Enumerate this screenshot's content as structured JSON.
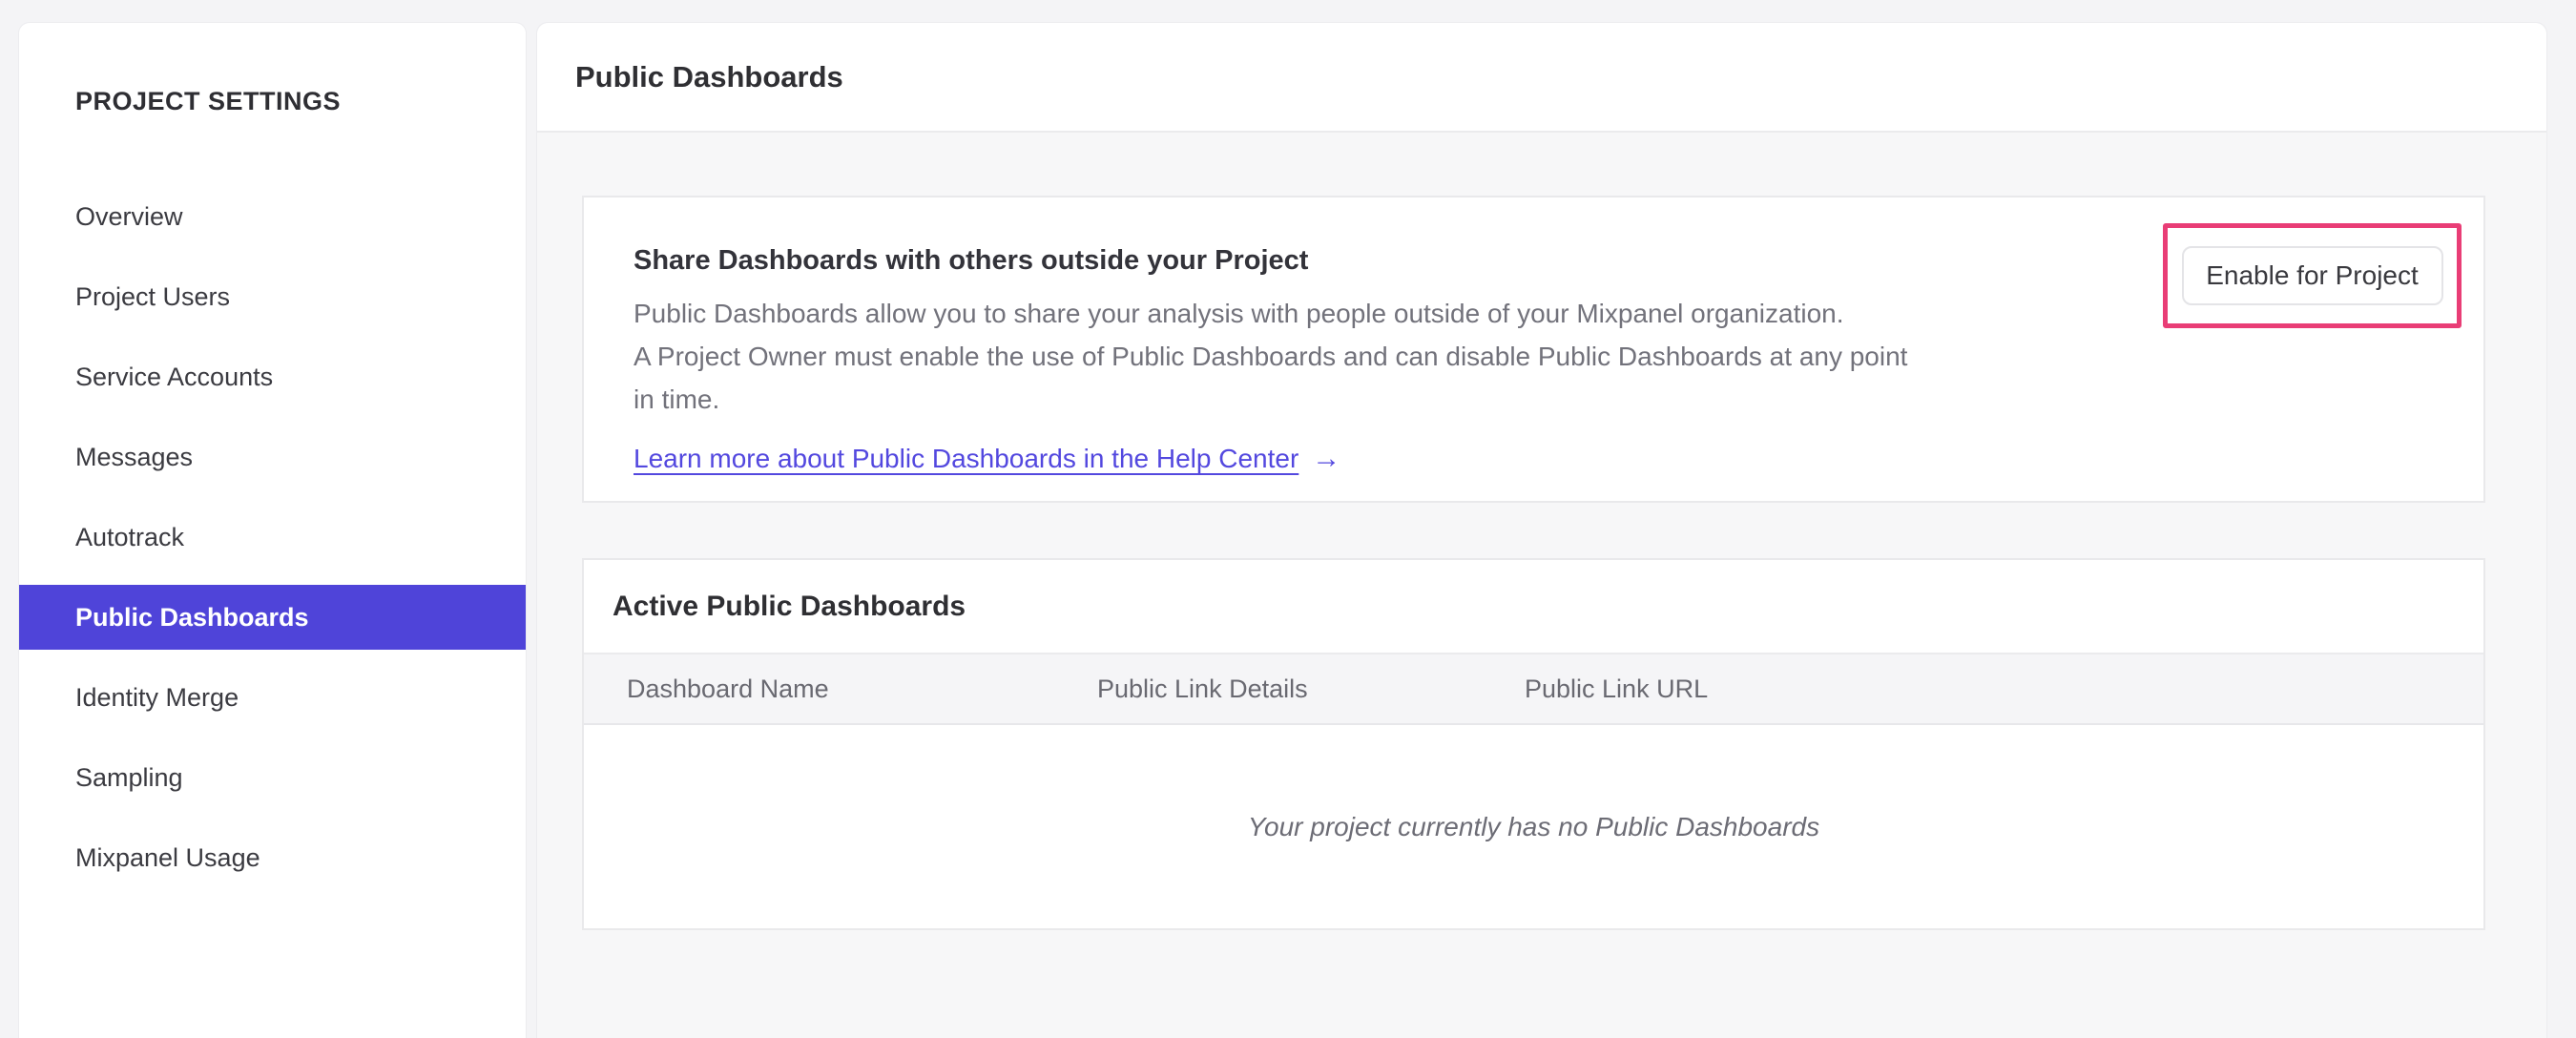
{
  "colors": {
    "accent_purple": "#4f44d9",
    "annotation_pink": "#e93d76",
    "link_purple": "#5348df",
    "page_background": "#f4f4f6"
  },
  "sidebar": {
    "title": "PROJECT SETTINGS",
    "items": [
      {
        "label": "Overview",
        "active": false
      },
      {
        "label": "Project Users",
        "active": false
      },
      {
        "label": "Service Accounts",
        "active": false
      },
      {
        "label": "Messages",
        "active": false
      },
      {
        "label": "Autotrack",
        "active": false
      },
      {
        "label": "Public Dashboards",
        "active": true
      },
      {
        "label": "Identity Merge",
        "active": false
      },
      {
        "label": "Sampling",
        "active": false
      },
      {
        "label": "Mixpanel Usage",
        "active": false
      }
    ]
  },
  "header": {
    "title": "Public Dashboards"
  },
  "share_card": {
    "title": "Share Dashboards with others outside your Project",
    "body_lines": [
      "Public Dashboards allow you to share your analysis with people outside of your Mixpanel organization.",
      "A Project Owner must enable the use of Public Dashboards and can disable Public Dashboards at any point",
      "in time."
    ],
    "link_label": "Learn more about Public Dashboards in the Help Center",
    "arrow": "→",
    "button_label": "Enable for Project"
  },
  "active_card": {
    "title": "Active Public Dashboards",
    "columns": [
      "Dashboard Name",
      "Public Link Details",
      "Public Link URL"
    ],
    "empty_message": "Your project currently has no Public Dashboards"
  }
}
